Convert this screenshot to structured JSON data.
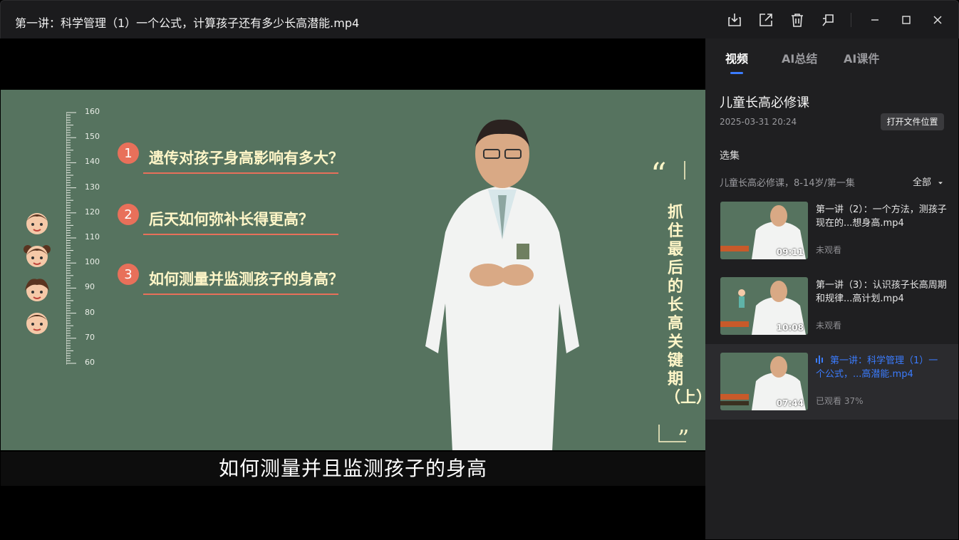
{
  "window": {
    "title": "第一讲：科学管理（1）一个公式，计算孩子还有多少长高潜能.mp4",
    "buttons": [
      "download-icon",
      "share-icon",
      "delete-icon",
      "pin-icon",
      "minimize-icon",
      "maximize-icon",
      "close-icon"
    ]
  },
  "video": {
    "ruler_labels": [
      "160",
      "150",
      "140",
      "130",
      "120",
      "110",
      "100",
      "90",
      "80",
      "70",
      "60"
    ],
    "questions": [
      {
        "num": "1",
        "text": "遗传对孩子身高影响有多大？"
      },
      {
        "num": "2",
        "text": "后天如何弥补长得更高？"
      },
      {
        "num": "3",
        "text": "如何测量并监测孩子的身高？"
      }
    ],
    "side_title": "抓住最后的长高关键期（上）",
    "subtitle": "如何测量并且监测孩子的身高"
  },
  "panel": {
    "tabs": [
      "视频",
      "AI总结",
      "AI课件"
    ],
    "active_tab": 0,
    "course_title": "儿童长高必修课",
    "course_date": "2025-03-31 20:24",
    "open_location_label": "打开文件位置",
    "section_label": "选集",
    "season_label": "儿童长高必修课，8-14岁/第一集",
    "filter_label": "全部",
    "episodes": [
      {
        "title": "第一讲（2）：一个方法，测孩子现在的...想身高.mp4",
        "duration": "09:11",
        "status": "未观看",
        "active": false
      },
      {
        "title": "第一讲（3）：认识孩子长高周期和规律...高计划.mp4",
        "duration": "10:08",
        "status": "未观看",
        "active": false
      },
      {
        "title": "第一讲：科学管理（1）一个公式，...高潜能.mp4",
        "duration": "07:44",
        "status": "已观看 37%",
        "active": true
      }
    ]
  },
  "colors": {
    "accent": "#3b7cff",
    "chalkboard": "#56735f",
    "question_badge": "#e8705a",
    "question_text": "#fff6c8"
  }
}
